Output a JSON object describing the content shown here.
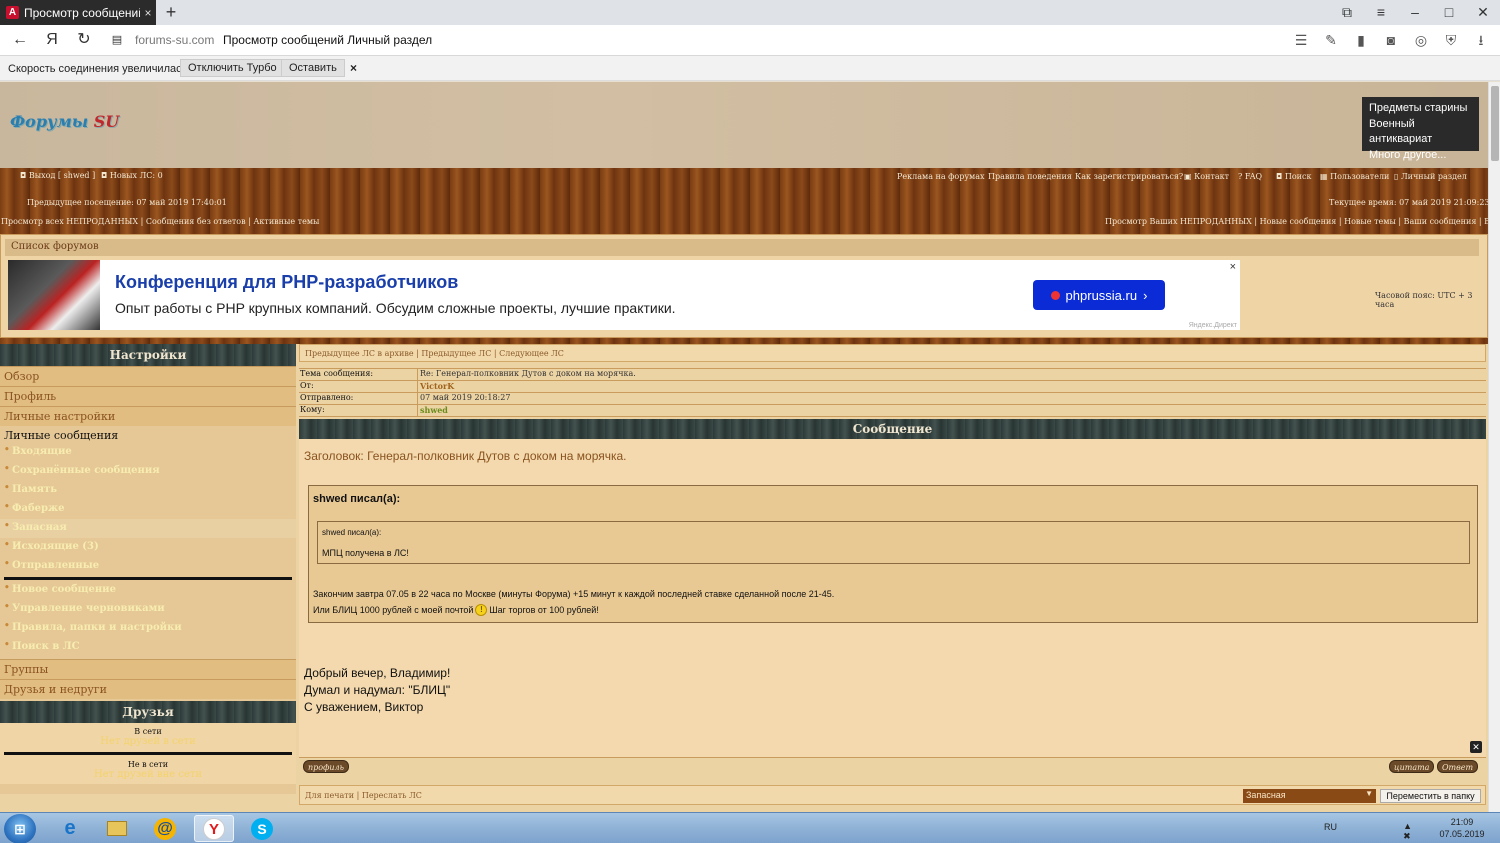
{
  "browser": {
    "tab_title": "Просмотр сообщений /",
    "tab_favicon": "A",
    "new_tab": "+",
    "tab_close": "×",
    "domain": "forums-su.com",
    "page_title": "Просмотр сообщений Личный раздел",
    "window_controls": [
      "⧉",
      "≡",
      "–",
      "□",
      "✕"
    ],
    "turbo_text": "Скорость соединения увеличилась.",
    "turbo_off": "Отключить Турбо",
    "turbo_keep": "Оставить",
    "turbo_close": "×"
  },
  "header": {
    "logo_main": "Форумы",
    "logo_su": "SU",
    "ad_lines": [
      "Предметы старины",
      "Военный антиквариат",
      "Много другое..."
    ]
  },
  "topnav": {
    "logout": "Выход [ shwed ]",
    "new_pm": "Новых ЛС: 0",
    "right_links": [
      "Реклама на форумах",
      "Правила поведения",
      "Как зарегистрироваться?",
      "Контакт",
      "FAQ",
      "Поиск",
      "Пользователи",
      "Личный раздел"
    ],
    "prev_visit": "Предыдущее посещение: 07 май 2019 17:40:01",
    "current_time": "Текущее время: 07 май 2019 21:09:23",
    "left_links": "Просмотр всех НЕПРОДАННЫХ | Сообщения без ответов | Активные темы",
    "right_links2": "Просмотр Ваших НЕПРОДАННЫХ | Новые сообщения | Новые темы | Ваши сообщения | Ваши темы"
  },
  "forum_list": "Список форумов",
  "yandex_ad": {
    "title": "Конференция для PHP-разработчиков",
    "desc": "Опыт работы с PHP крупных компаний. Обсудим сложные проекты, лучшие практики.",
    "button": "phprussia.ru",
    "button_arrow": "›",
    "close": "×",
    "source": "Яндекс.Директ"
  },
  "timezone": "Часовой пояс: UTC + 3 часа",
  "sidebar": {
    "settings_title": "Настройки",
    "items": [
      "Обзор",
      "Профиль",
      "Личные настройки"
    ],
    "pm_section": "Личные сообщения",
    "pm_items": [
      "Входящие",
      "Сохранённые сообщения",
      "Память",
      "Фаберже",
      "Запасная",
      "Исходящие (3)",
      "Отправленные"
    ],
    "pm_items2": [
      "Новое сообщение",
      "Управление черновиками",
      "Правила, папки и настройки",
      "Поиск в ЛС"
    ],
    "groups": "Группы",
    "friends_foes": "Друзья и недруги",
    "friends_title": "Друзья",
    "online_cap": "В сети",
    "online_none": "Нет друзей в сети",
    "offline_cap": "Не в сети",
    "offline_none": "Нет друзей вне сети"
  },
  "pm": {
    "crumbs": "Предыдущее ЛС в архиве | Предыдущее ЛС | Следующее ЛС",
    "subject_label": "Тема сообщения:",
    "subject_value": "Re: Генерал-полковник Дутов с доком на морячка.",
    "from_label": "От:",
    "from_value": "VictorK",
    "sent_label": "Отправлено:",
    "sent_value": "07 май 2019 20:18:27",
    "to_label": "Кому:",
    "to_value": "shwed",
    "message_title": "Сообщение",
    "heading": "Заголовок: Генерал-полковник Дутов с доком на морячка.",
    "quote_author": "shwed писал(а):",
    "inner_quote_author": "shwed писал(а):",
    "inner_quote_text": "МПЦ получена в ЛС!",
    "quote_line1": "Закончим завтра 07.05 в 22 часа по Москве (минуты Форума) +15 минут к каждой последней ставке сделанной после 21-45.",
    "quote_line2a": "Или БЛИЦ 1000 рублей с моей почтой",
    "quote_line2b": "Шаг торгов от 100 рублей!",
    "smile": "!",
    "greeting": [
      "Добрый вечер, Владимир!",
      "Думал и надумал: \"БЛИЦ\"",
      "С уважением, Виктор"
    ],
    "close": "✕",
    "profile_btn": "профиль",
    "quote_btn": "цитата",
    "reply_btn": "Ответ",
    "footer_links": "Для печати | Переслать ЛС",
    "folder_select": "Запасная",
    "select_arrow": "▼",
    "move_btn": "Переместить в папку"
  },
  "taskbar": {
    "start": "⊞",
    "lang": "RU",
    "tray": "▲ ✖ ▮ ◀",
    "time": "21:09",
    "date": "07.05.2019"
  },
  "colors": {
    "page_bg": "#ecd3a4",
    "wood": "#7a3c12",
    "accent_blue": "#0b2bd6"
  }
}
